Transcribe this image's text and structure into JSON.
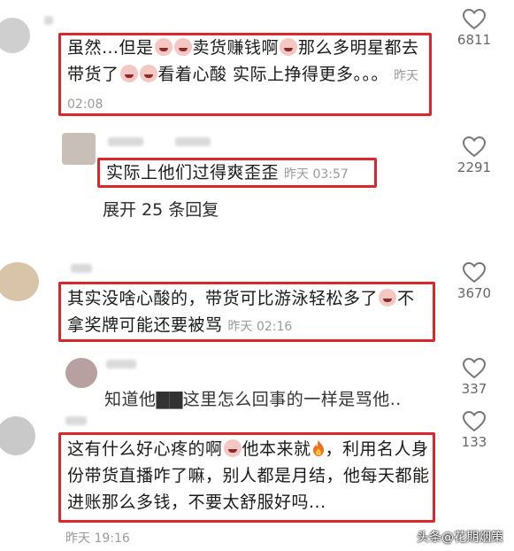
{
  "comments": [
    {
      "text_parts": [
        "虽然…但是",
        "卖货赚钱啊",
        "那么多明星都去带货了",
        "看着心酸 实际上挣得更多。。。"
      ],
      "time": "昨天 02:08",
      "likes": "6811"
    },
    {
      "text": "实际上他们过得爽歪歪",
      "time": "昨天 03:57",
      "likes": "2291",
      "expand_label": "展开 25 条回复"
    },
    {
      "text_parts": [
        "其实没啥心酸的，带货可比游泳轻松多了",
        "不拿奖牌可能还要被骂"
      ],
      "time": "昨天 02:16",
      "likes": "3670"
    },
    {
      "text": "知道他▇▇这里怎么回事的一样是骂他..",
      "likes": "337"
    },
    {
      "text_parts": [
        "这有什么好心疼的啊",
        "他本来就",
        "，利用名人身份带货直播咋了嘛，别人都是月结，他每天都能进账那么多钱，不要太舒服好吗..."
      ],
      "time": "昨天 19:16",
      "likes": "133"
    }
  ],
  "watermark": "头条@花期烟策",
  "icons": {
    "like": "heart-outline-icon",
    "emoji": "crying-face-emoji-icon",
    "fire": "fire-emoji-icon"
  },
  "colors": {
    "highlight": "#d9272e",
    "timestamp": "#9a9a9a"
  }
}
